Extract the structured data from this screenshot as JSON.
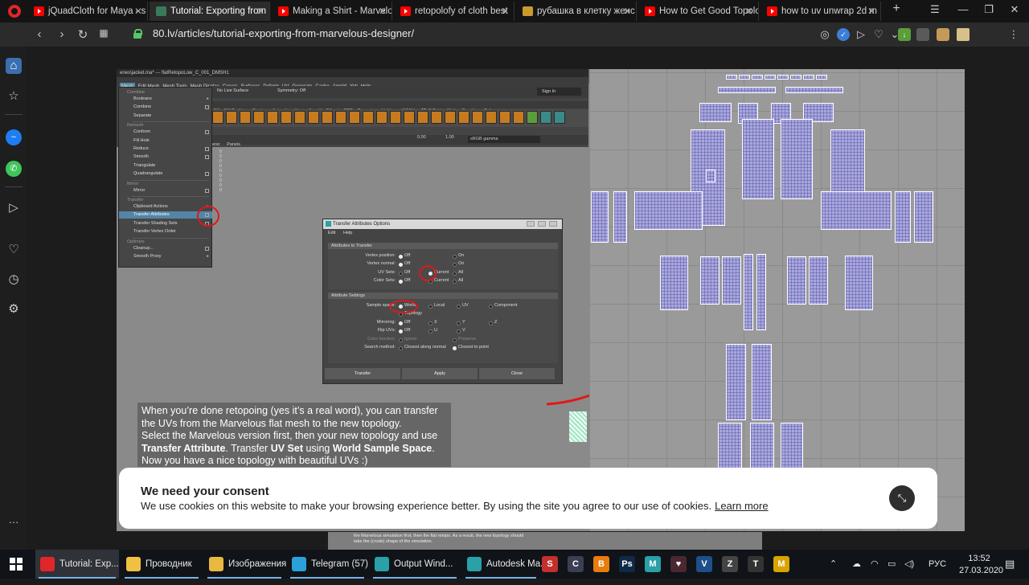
{
  "browser": {
    "tabs": [
      {
        "label": "jQuadCloth for Maya - s",
        "fav": "yt"
      },
      {
        "label": "Tutorial: Exporting from",
        "fav": "tut",
        "active": true
      },
      {
        "label": "Making a Shirt - Marvelo",
        "fav": "yt"
      },
      {
        "label": "retopolofy of cloth best",
        "fav": "yt"
      },
      {
        "label": "рубашка в клетку женс",
        "fav": "shirt"
      },
      {
        "label": "How to Get Good Topolo",
        "fav": "yt"
      },
      {
        "label": "how to uv unwrap 2d m",
        "fav": "yt"
      }
    ],
    "new_tab": "+",
    "url": "80.lv/articles/tutorial-exporting-from-marvelous-designer/"
  },
  "maya": {
    "title": "enes\\jacket.ma* --- flatRetopoLow_C_001_DMSH1",
    "menu": [
      "Mesh",
      "Edit Mesh",
      "Mesh Tools",
      "Mesh Display",
      "Curves",
      "Surfaces",
      "Deform",
      "UV",
      "Generate",
      "Cache",
      "Arnold",
      "Yeti",
      "Help"
    ],
    "toolbar": {
      "live": "No Live Surface",
      "symmetry": "Symmetry: Off",
      "sign_in": "Sign In"
    },
    "shelf_tabs": [
      "FX",
      "FX Caching",
      "Custom",
      "Animation_User",
      "Arnold",
      "Bifrost",
      "CRT",
      "Dynamics",
      "Lighting",
      "MASH",
      "Modeling",
      "Motion Graphics",
      "Polygons"
    ],
    "view": {
      "left": "erer",
      "panels": "Panels",
      "val1": "0.00",
      "val2": "1.00",
      "gamma": "sRGB gamma"
    },
    "menu_rows": [
      {
        "t": "Combine",
        "kind": "hdr"
      },
      {
        "t": "Booleans",
        "kind": "arr"
      },
      {
        "t": "Combine",
        "kind": "box"
      },
      {
        "t": "Separate",
        "kind": ""
      },
      {
        "t": "Remesh",
        "kind": "hdr"
      },
      {
        "t": "Conform",
        "kind": "box"
      },
      {
        "t": "Fill Hole",
        "kind": ""
      },
      {
        "t": "Reduce",
        "kind": "box"
      },
      {
        "t": "Smooth",
        "kind": "box"
      },
      {
        "t": "Triangulate",
        "kind": ""
      },
      {
        "t": "Quadrangulate",
        "kind": "box"
      },
      {
        "t": "Mirror",
        "kind": "hdr"
      },
      {
        "t": "Mirror",
        "kind": "box"
      },
      {
        "t": "Transfer",
        "kind": "hdr"
      },
      {
        "t": "Clipboard Actions",
        "kind": "arr"
      },
      {
        "t": "Transfer Attributes",
        "kind": "hi"
      },
      {
        "t": "Transfer Shading Sets",
        "kind": "box"
      },
      {
        "t": "Transfer Vertex Order",
        "kind": ""
      },
      {
        "t": "Optimize",
        "kind": "hdr"
      },
      {
        "t": "Cleanup...",
        "kind": "box"
      },
      {
        "t": "Smooth Proxy",
        "kind": "arr"
      }
    ]
  },
  "dialog": {
    "title": "Transfer Attributes Options",
    "menu": [
      "Edit",
      "Help"
    ],
    "sec_attributes": "Attributes to Transfer",
    "sec_settings": "Attribute Settings",
    "rows": {
      "vertex_position": "Vertex position:",
      "vertex_normal": "Vertex normal:",
      "uv_sets": "UV Sets:",
      "color_sets": "Color Sets:",
      "sample_space": "Sample space:",
      "mirroring": "Mirroring:",
      "flip_uvs": "Flip UVs:",
      "color_borders": "Color borders:",
      "search_method": "Search method:"
    },
    "opts": {
      "off": "Off",
      "on": "On",
      "current": "Current",
      "all": "All",
      "world": "World",
      "local": "Local",
      "uv": "UV",
      "component": "Component",
      "topology": "Topology",
      "x": "X",
      "y": "Y",
      "z": "Z",
      "u": "U",
      "v": "V",
      "ignore": "Ignore",
      "preserve": "Preserve",
      "closest_normal": "Closest along normal",
      "closest_point": "Closest to point"
    },
    "buttons": {
      "transfer": "Transfer",
      "apply": "Apply",
      "close": "Close"
    }
  },
  "caption": {
    "l1": "When you’re done retopoing (yes it’s a real word), you can transfer",
    "l2": "the UVs from the Marvelous flat mesh to the new topology.",
    "l3a": "Select the Marvelous version first, then your new topology and use",
    "l4a": "Transfer Attribute",
    "l4b": ". Transfer ",
    "l4c": "UV Set",
    "l4d": " using ",
    "l4e": "World Sample Space",
    "l4f": ".",
    "l5": "Now you have a nice topology with beautiful UVs :)"
  },
  "bottom_text": "the Marvelous simulation first, then the flat retopo. As a result, the new topology should take the (crude) shape of the simulation.",
  "consent": {
    "title": "We need your consent",
    "body": "We use cookies on this website to make your browsing experience better. By using the site you agree to our use of cookies.",
    "link": "Learn more"
  },
  "taskbar": {
    "items": [
      {
        "label": "Tutorial: Exp...",
        "color": "#e0262a",
        "active": true
      },
      {
        "label": "Проводник",
        "color": "#f0c040"
      },
      {
        "label": "Изображения",
        "color": "#e8b840"
      },
      {
        "label": "Telegram (57)",
        "color": "#2aa1da"
      },
      {
        "label": "Output Wind...",
        "color": "#2aa0a8"
      },
      {
        "label": "Autodesk Ma...",
        "color": "#2aa0a8"
      }
    ],
    "apps": [
      {
        "t": "S",
        "c": "#c4302b"
      },
      {
        "t": "C",
        "c": "#3a3f52"
      },
      {
        "t": "B",
        "c": "#e87d0d"
      },
      {
        "t": "Ps",
        "c": "#0f2a47"
      },
      {
        "t": "M",
        "c": "#2aa0a8"
      },
      {
        "t": "♥",
        "c": "#4a2830"
      },
      {
        "t": "V",
        "c": "#1d4f8a"
      },
      {
        "t": "Z",
        "c": "#444"
      },
      {
        "t": "T",
        "c": "#333"
      },
      {
        "t": "M",
        "c": "#d9a400"
      }
    ],
    "lang": "РУС",
    "time": "13:52",
    "date": "27.03.2020"
  }
}
